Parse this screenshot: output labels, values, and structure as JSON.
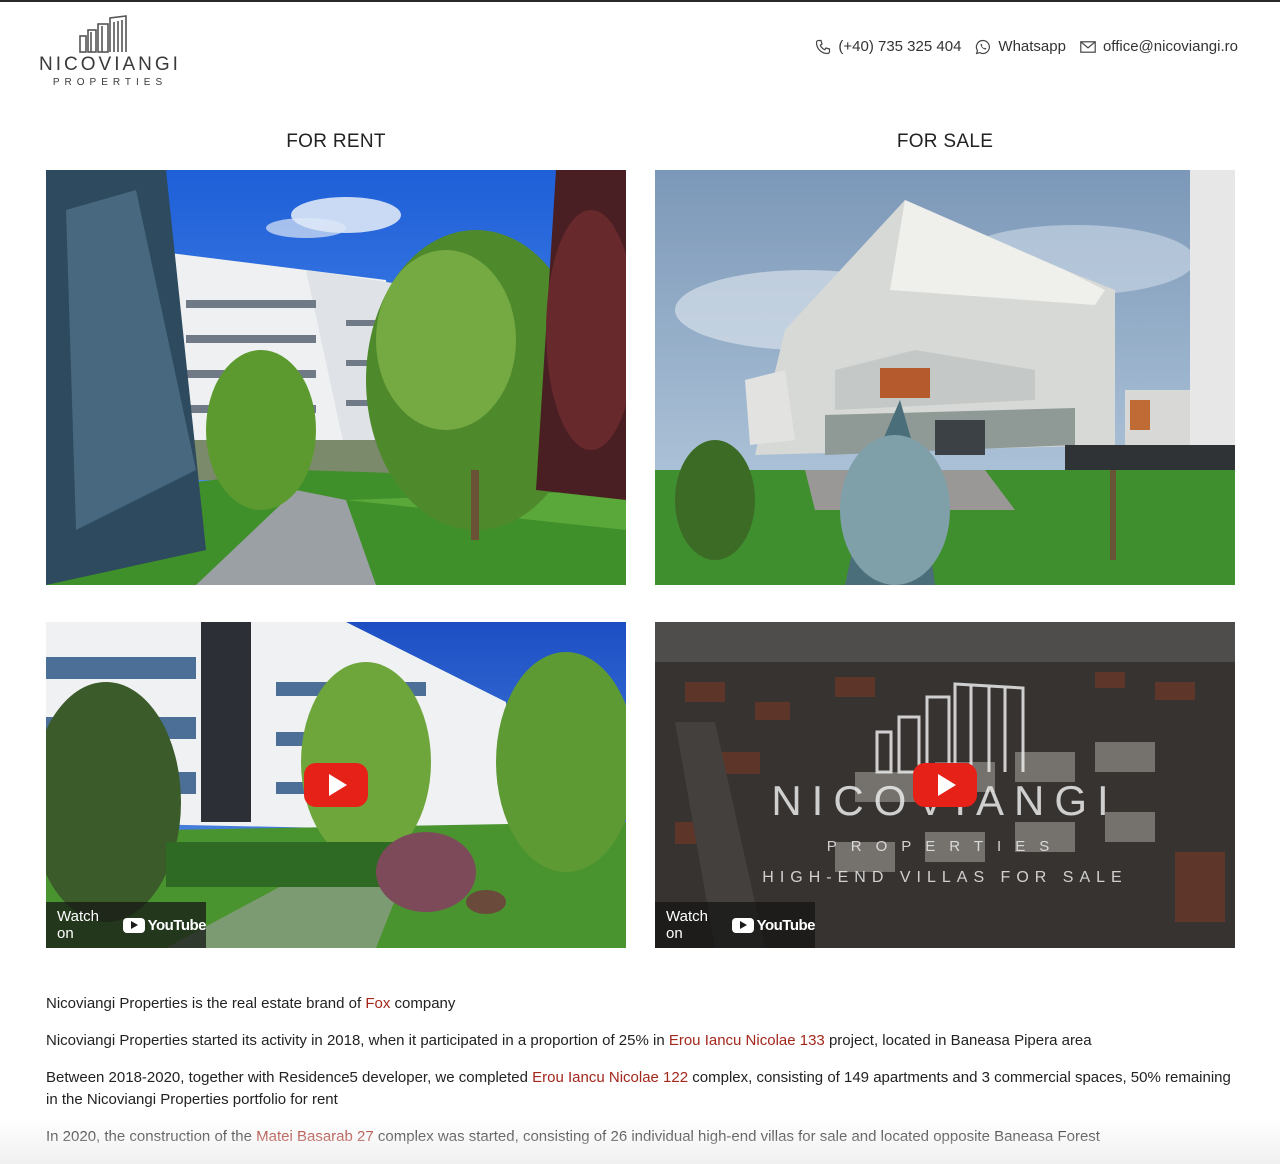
{
  "brand": {
    "name": "NICOVIANGI",
    "sub": "PROPERTIES"
  },
  "contacts": {
    "phone": "(+40) 735 325 404",
    "whatsapp": "Whatsapp",
    "email": "office@nicoviangi.ro"
  },
  "columns": [
    {
      "title": "FOR RENT"
    },
    {
      "title": "FOR SALE"
    }
  ],
  "videos": [
    {
      "watch_label": "Watch on",
      "yt_label": "YouTube"
    },
    {
      "watch_label": "Watch on",
      "yt_label": "YouTube",
      "overlay": {
        "name": "NICOVIANGI",
        "sub": "PROPERTIES",
        "tagline": "HIGH-END VILLAS FOR SALE"
      }
    }
  ],
  "about": {
    "p1": {
      "before": "Nicoviangi Properties is the real estate brand of ",
      "link": "Fox",
      "after": " company"
    },
    "p2": {
      "before": "Nicoviangi Properties started its activity in 2018, when it participated in a proportion of 25% in ",
      "link": "Erou Iancu Nicolae 133",
      "after": " project, located in Baneasa Pipera area"
    },
    "p3": {
      "before": "Between 2018-2020, together with Residence5 developer, we completed ",
      "link": "Erou Iancu Nicolae 122",
      "after": " complex, consisting of 149 apartments and 3 commercial spaces, 50% remaining in the Nicoviangi Properties portfolio for rent"
    },
    "p4": {
      "before": "In 2020, the construction of the ",
      "link": "Matei Basarab 27",
      "after": " complex was started, consisting of 26 individual high-end villas for sale and located opposite Baneasa Forest"
    }
  },
  "colors": {
    "link": "#a3271b",
    "play": "#e62117"
  },
  "icons": {
    "phone": "phone-icon",
    "whatsapp": "whatsapp-icon",
    "email": "envelope-icon"
  }
}
